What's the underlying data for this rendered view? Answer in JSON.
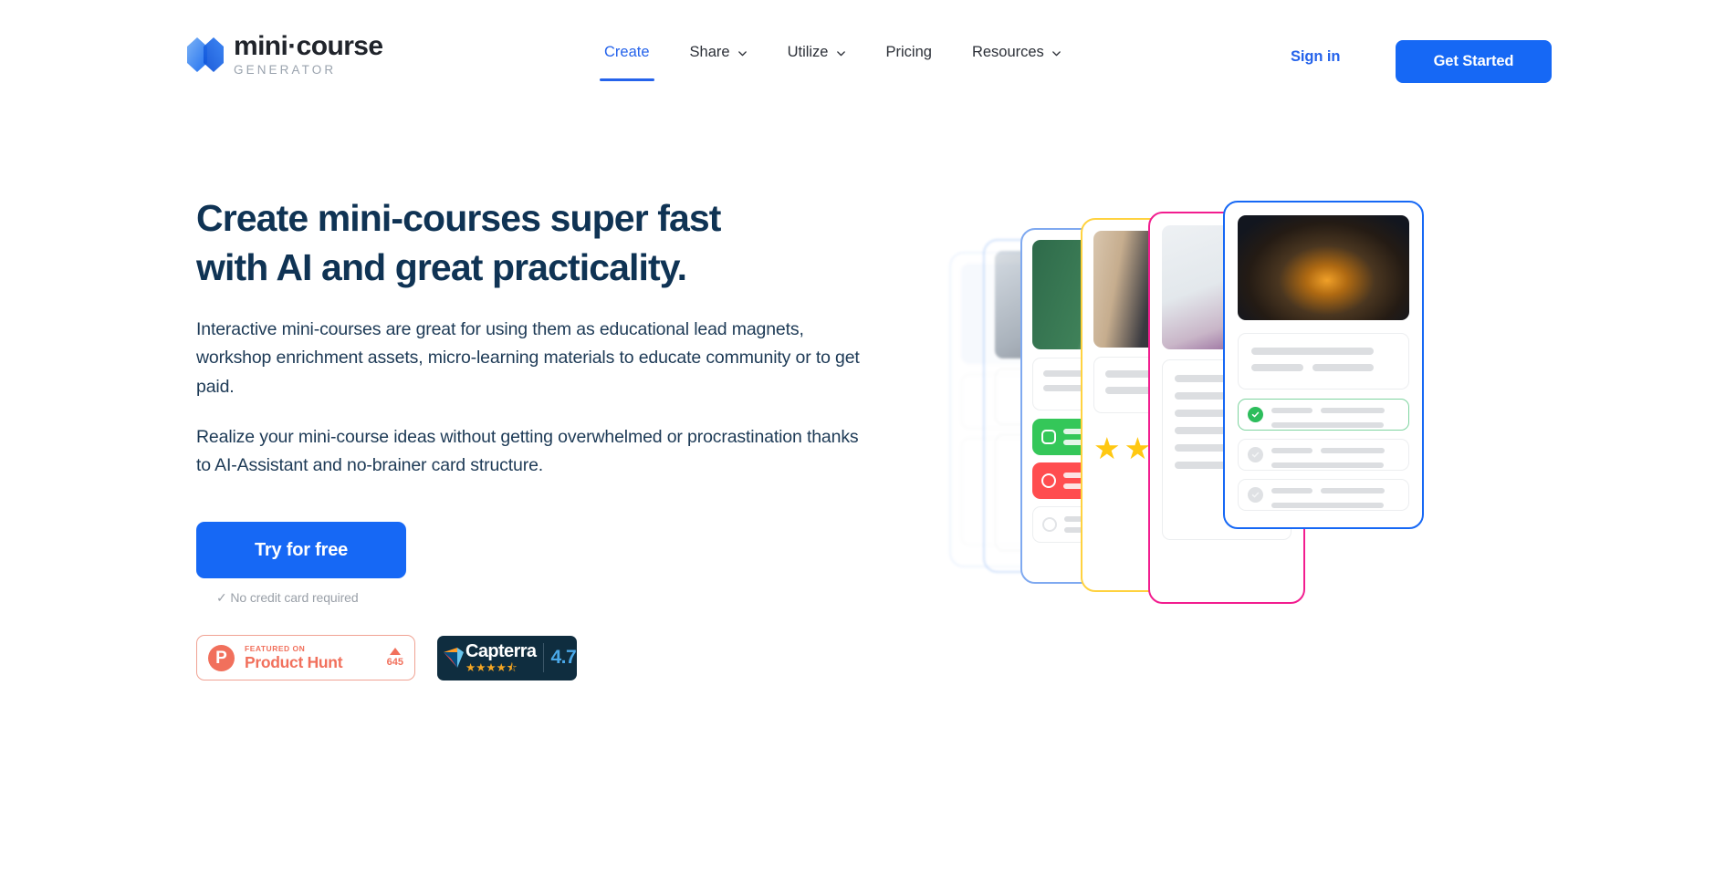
{
  "brand": {
    "name": "mini·course",
    "subtitle": "GENERATOR",
    "logo_icon": "minicourse-logo-icon",
    "primary_color": "#1668f5",
    "headline_color": "#0f3354"
  },
  "nav": {
    "items": [
      {
        "label": "Create",
        "has_dropdown": false,
        "active": true
      },
      {
        "label": "Share",
        "has_dropdown": true,
        "active": false
      },
      {
        "label": "Utilize",
        "has_dropdown": true,
        "active": false
      },
      {
        "label": "Pricing",
        "has_dropdown": false,
        "active": false
      },
      {
        "label": "Resources",
        "has_dropdown": true,
        "active": false
      }
    ],
    "sign_in_label": "Sign in",
    "get_started_label": "Get Started"
  },
  "hero": {
    "headline_line1": "Create mini-courses super fast",
    "headline_line2": "with AI and great practicality.",
    "paragraph1": "Interactive mini-courses are great for using them as educational lead magnets, workshop enrichment assets, micro-learning materials to educate community or to get paid.",
    "paragraph2": "Realize your mini-course ideas without getting overwhelmed or procrastination thanks to AI-Assistant and no-brainer card structure.",
    "cta_label": "Try for free",
    "no_credit_card": "✓ No credit card required"
  },
  "badges": {
    "product_hunt": {
      "featured_label": "FEATURED ON",
      "name": "Product Hunt",
      "upvotes": "645",
      "icon": "product-hunt-icon",
      "color": "#f1705c"
    },
    "capterra": {
      "name": "Capterra",
      "score": "4.7",
      "stars": "★★★★⯪",
      "icon": "capterra-flag-icon",
      "bg_color": "#0f2d3f",
      "score_color": "#4aa8e8"
    }
  },
  "illustration": {
    "name": "mini-course-card-stack",
    "cards": [
      {
        "id": "card-1",
        "border_color": "#c8dcfb",
        "opacity": 0.3,
        "blur": true,
        "label": "ghost-card-far"
      },
      {
        "id": "card-2",
        "border_color": "#aecbf7",
        "opacity": 0.55,
        "blur": true,
        "label": "ghost-card-classroom"
      },
      {
        "id": "card-3",
        "border_color": "#7fa9f0",
        "opacity": 1.0,
        "blur": false,
        "label": "card-blackboard-quiz"
      },
      {
        "id": "card-4",
        "border_color": "#ffd23f",
        "opacity": 1.0,
        "blur": false,
        "label": "card-rating-stars"
      },
      {
        "id": "card-5",
        "border_color": "#f21d8f",
        "opacity": 1.0,
        "blur": false,
        "label": "card-yoga-text"
      },
      {
        "id": "card-6",
        "border_color": "#1668f5",
        "opacity": 1.0,
        "blur": false,
        "label": "card-walle-checklist"
      }
    ],
    "front_card": {
      "image_alt": "walle-robot-photo",
      "correct_option_color": "#2dbd5c",
      "option_count": 3
    }
  }
}
